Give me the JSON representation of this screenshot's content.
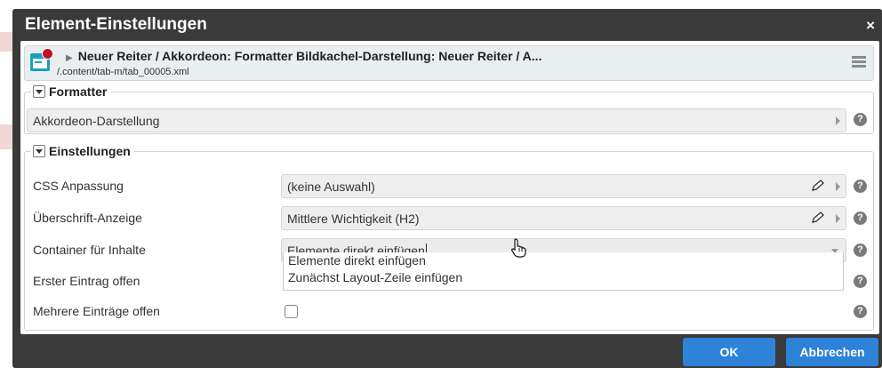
{
  "dialog": {
    "title": "Element-Einstellungen",
    "close_label": "×"
  },
  "resource": {
    "title": "Neuer Reiter / Akkordeon: Formatter Bildkachel-Darstellung: Neuer Reiter / A...",
    "path": "/.content/tab-m/tab_00005.xml"
  },
  "formatter_section": {
    "legend": "Formatter",
    "value": "Akkordeon-Darstellung"
  },
  "settings_section": {
    "legend": "Einstellungen",
    "rows": [
      {
        "label": "CSS Anpassung",
        "value": "(keine Auswahl)"
      },
      {
        "label": "Überschrift-Anzeige",
        "value": "Mittlere Wichtigkeit (H2)"
      },
      {
        "label": "Container für Inhalte",
        "value": "Elemente direkt einfügen"
      },
      {
        "label": "Erster Eintrag offen"
      },
      {
        "label": "Mehrere Einträge offen"
      }
    ],
    "dropdown_options": [
      "Elemente direkt einfügen",
      "Zunächst Layout-Zeile einfügen"
    ]
  },
  "help_glyph": "?",
  "buttons": {
    "ok": "OK",
    "cancel": "Abbrechen"
  },
  "colors": {
    "dialog_bg": "#3a3a3a",
    "primary_button": "#2e82d8",
    "icon_teal": "#1aa0b8",
    "badge_red": "#c0102a"
  },
  "icons": [
    "page-icon",
    "menu-icon",
    "help-icon",
    "pencil-icon",
    "chevron-right-icon",
    "chevron-down-icon",
    "close-icon",
    "hand-cursor-icon"
  ]
}
